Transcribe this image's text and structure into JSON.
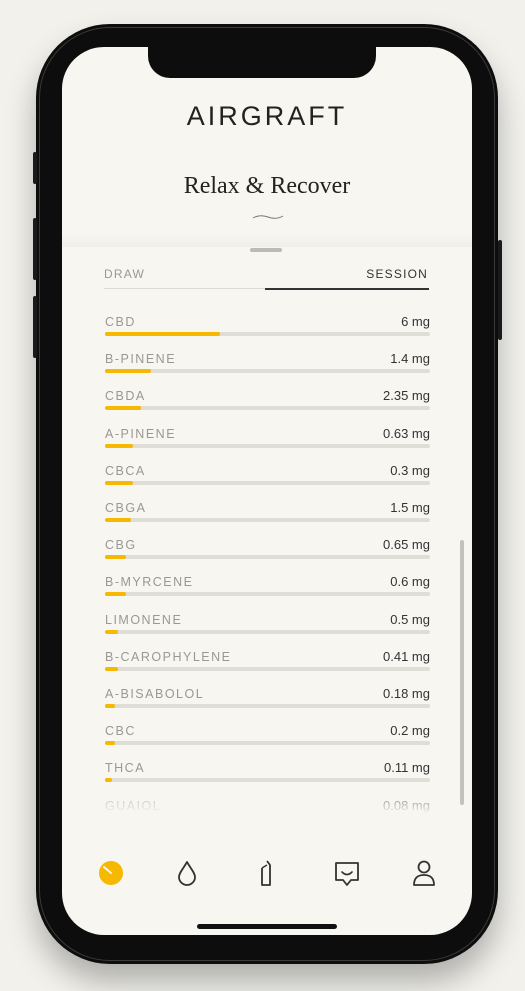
{
  "app": {
    "logo": "AIRGRAFT",
    "title": "Relax & Recover"
  },
  "tabs": {
    "draw": "DRAW",
    "session": "SESSION",
    "active": "session"
  },
  "colors": {
    "accent": "#f6b800",
    "track": "#e0ddd6",
    "background": "#f7f6f1"
  },
  "compounds": [
    {
      "name": "CBD",
      "value": "6 mg",
      "fill": 0.355
    },
    {
      "name": "B-PINENE",
      "value": "1.4 mg",
      "fill": 0.14
    },
    {
      "name": "CBDA",
      "value": "2.35 mg",
      "fill": 0.11
    },
    {
      "name": "A-PINENE",
      "value": "0.63 mg",
      "fill": 0.085
    },
    {
      "name": "CBCA",
      "value": "0.3 mg",
      "fill": 0.085
    },
    {
      "name": "CBGA",
      "value": "1.5 mg",
      "fill": 0.08
    },
    {
      "name": "CBG",
      "value": "0.65 mg",
      "fill": 0.065
    },
    {
      "name": "B-MYRCENE",
      "value": "0.6 mg",
      "fill": 0.065
    },
    {
      "name": "LIMONENE",
      "value": "0.5 mg",
      "fill": 0.04
    },
    {
      "name": "B-CAROPHYLENE",
      "value": "0.41 mg",
      "fill": 0.04
    },
    {
      "name": "A-BISABOLOL",
      "value": "0.18 mg",
      "fill": 0.03
    },
    {
      "name": "CBC",
      "value": "0.2 mg",
      "fill": 0.03
    },
    {
      "name": "THCA",
      "value": "0.11 mg",
      "fill": 0.02
    },
    {
      "name": "GUAIOL",
      "value": "0.08 mg",
      "fill": 0.02
    }
  ],
  "nav": [
    {
      "icon": "dashboard-icon",
      "active": true
    },
    {
      "icon": "drop-icon",
      "active": false
    },
    {
      "icon": "pen-icon",
      "active": false
    },
    {
      "icon": "chat-icon",
      "active": false
    },
    {
      "icon": "profile-icon",
      "active": false
    }
  ]
}
